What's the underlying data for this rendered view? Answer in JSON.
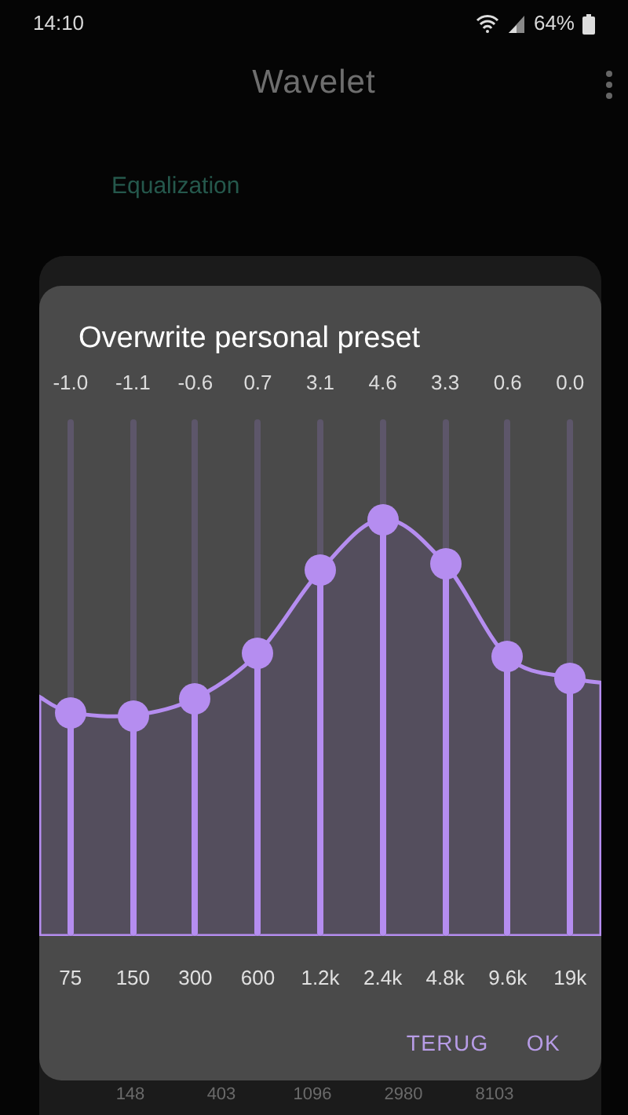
{
  "status_bar": {
    "time": "14:10",
    "battery": "64%"
  },
  "app_bar": {
    "title": "Wavelet"
  },
  "section": {
    "title": "Equalization"
  },
  "background_scale": [
    "148",
    "403",
    "1096",
    "2980",
    "8103"
  ],
  "dialog": {
    "title": "Overwrite personal preset",
    "bands": [
      {
        "value": "-1.0",
        "frequency": "75",
        "level": 0.433
      },
      {
        "value": "-1.1",
        "frequency": "150",
        "level": 0.427
      },
      {
        "value": "-0.6",
        "frequency": "300",
        "level": 0.46
      },
      {
        "value": "0.7",
        "frequency": "600",
        "level": 0.547
      },
      {
        "value": "3.1",
        "frequency": "1.2k",
        "level": 0.707
      },
      {
        "value": "4.6",
        "frequency": "2.4k",
        "level": 0.807
      },
      {
        "value": "3.3",
        "frequency": "4.8k",
        "level": 0.72
      },
      {
        "value": "0.6",
        "frequency": "9.6k",
        "level": 0.54
      },
      {
        "value": "0.0",
        "frequency": "19k",
        "level": 0.5
      }
    ],
    "buttons": [
      "TERUG",
      "OK"
    ]
  }
}
